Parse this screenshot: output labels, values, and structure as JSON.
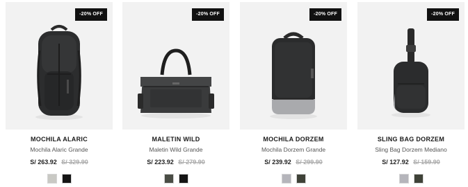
{
  "products": [
    {
      "badge": "-20% OFF",
      "name": "MOCHILA ALARIC",
      "subtitle": "Mochila Alaric Grande",
      "price": "S/ 263.92",
      "old_price": "S/ 329.90",
      "image_icon": "backpack-icon",
      "swatches": [
        "#c9c9c4",
        "#151515"
      ]
    },
    {
      "badge": "-20% OFF",
      "name": "MALETIN WILD",
      "subtitle": "Maletin Wild Grande",
      "price": "S/ 223.92",
      "old_price": "S/ 279.90",
      "image_icon": "duffel-bag-icon",
      "swatches": [
        "#4a4d45",
        "#151515"
      ]
    },
    {
      "badge": "-20% OFF",
      "name": "MOCHILA DORZEM",
      "subtitle": "Mochila Dorzem Grande",
      "price": "S/ 239.92",
      "old_price": "S/ 299.90",
      "image_icon": "backpack-icon",
      "swatches": [
        "#b5b5bb",
        "#3f4238"
      ]
    },
    {
      "badge": "-20% OFF",
      "name": "SLING BAG DORZEM",
      "subtitle": "Sling Bag Dorzem Mediano",
      "price": "S/ 127.92",
      "old_price": "S/ 159.90",
      "image_icon": "sling-bag-icon",
      "swatches": [
        "#b5b5bb",
        "#3f4238"
      ]
    }
  ]
}
